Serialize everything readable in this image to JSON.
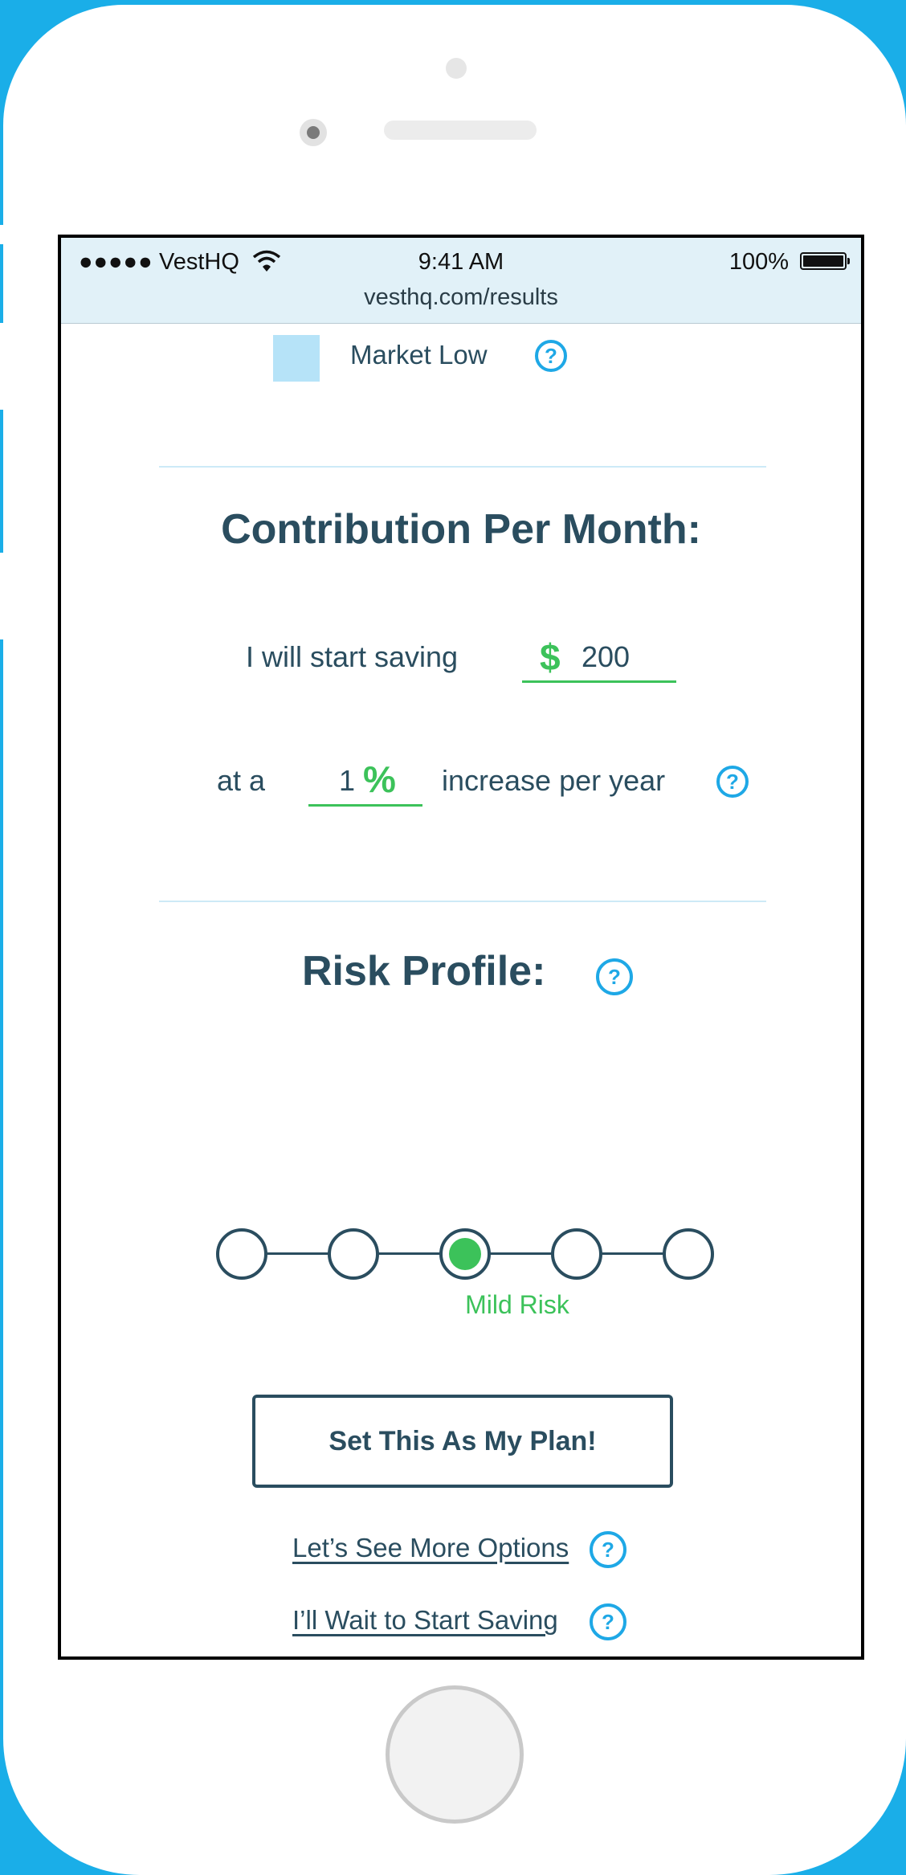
{
  "status_bar": {
    "signal": "●●●●●",
    "carrier": "VestHQ",
    "time": "9:41 AM",
    "battery": "100%",
    "url": "vesthq.com/results"
  },
  "legend": {
    "label": "Market Low",
    "color": "#b6e3f8"
  },
  "contribution": {
    "title": "Contribution Per Month:",
    "start_prefix": "I will start saving",
    "currency_symbol": "$",
    "amount": "200",
    "rate_prefix": "at a",
    "rate_value": "1",
    "rate_symbol": "%",
    "rate_suffix": "increase per year"
  },
  "risk": {
    "title": "Risk Profile:",
    "levels": 5,
    "selected_index": 2,
    "selected_label": "Mild Risk"
  },
  "actions": {
    "primary": "Set This As My Plan!",
    "more_options": "Let’s See More Options",
    "wait": "I’ll Wait to Start Saving"
  },
  "help_glyph": "?",
  "colors": {
    "accent_blue": "#1ea8e6",
    "accent_green": "#3cc25a",
    "text_dark": "#2a4d5f",
    "frame_blue": "#1aaee8"
  }
}
